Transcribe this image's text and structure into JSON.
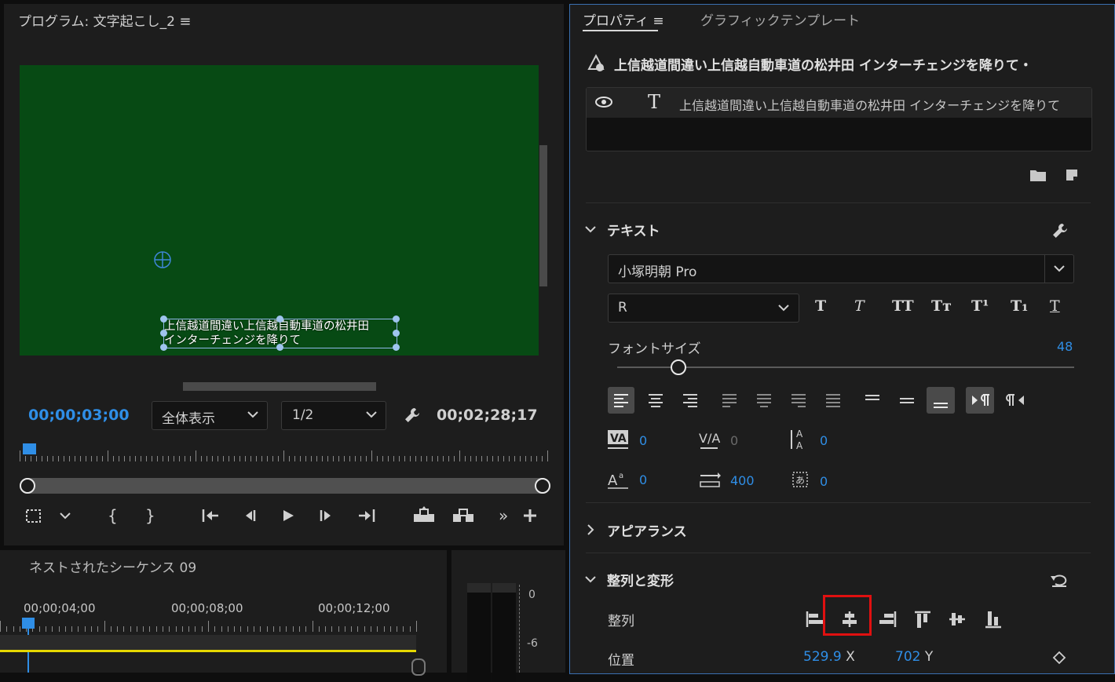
{
  "program": {
    "title": "プログラム: 文字起こし_2",
    "menu_icon": "hamburger-icon",
    "video_bg": "#074a14",
    "caption_line1": "上信越道間違い上信越自動車道の松井田",
    "caption_line2": "インターチェンジを降りて",
    "timecode_current": "00;00;03;00",
    "zoom_select": "全体表示",
    "resolution_select": "1/2",
    "timecode_duration": "00;02;28;17"
  },
  "timeline": {
    "title": "ネストされたシーケンス 09",
    "ruler_labels": [
      "00;00;04;00",
      "00;00;08;00",
      "00;00;12;00"
    ],
    "meter_labels": [
      "0",
      "-6"
    ],
    "track_color": "#e6d800"
  },
  "properties": {
    "tab_active": "プロパティ",
    "tab_menu_icon": "hamburger-icon",
    "tab_other": "グラフィックテンプレート",
    "layer_title": "上信越道間違い上信越自動車道の松井田 インターチェンジを降りて・",
    "layer_item_text": "上信越道間違い上信越自動車道の松井田 インターチェンジを降りて",
    "text_section": {
      "header": "テキスト",
      "font_family": "小塚明朝 Pro",
      "font_style": "R",
      "style_buttons": [
        "T",
        "T",
        "TT",
        "Tт",
        "T¹",
        "T₁",
        "T"
      ],
      "font_size_label": "フォントサイズ",
      "font_size_value": "48",
      "font_size_slider": 0.13,
      "kerning": "0",
      "tracking": "0",
      "leading": "0",
      "baseline_shift": "0",
      "tab_width": "400",
      "tsume": "0"
    },
    "appearance_header": "アピアランス",
    "align_section": {
      "header": "整列と変形",
      "align_label": "整列",
      "position_label": "位置",
      "position_x": "529.9",
      "x_suffix": "X",
      "position_y": "702",
      "y_suffix": "Y"
    },
    "highlight_color": "#e01010"
  }
}
